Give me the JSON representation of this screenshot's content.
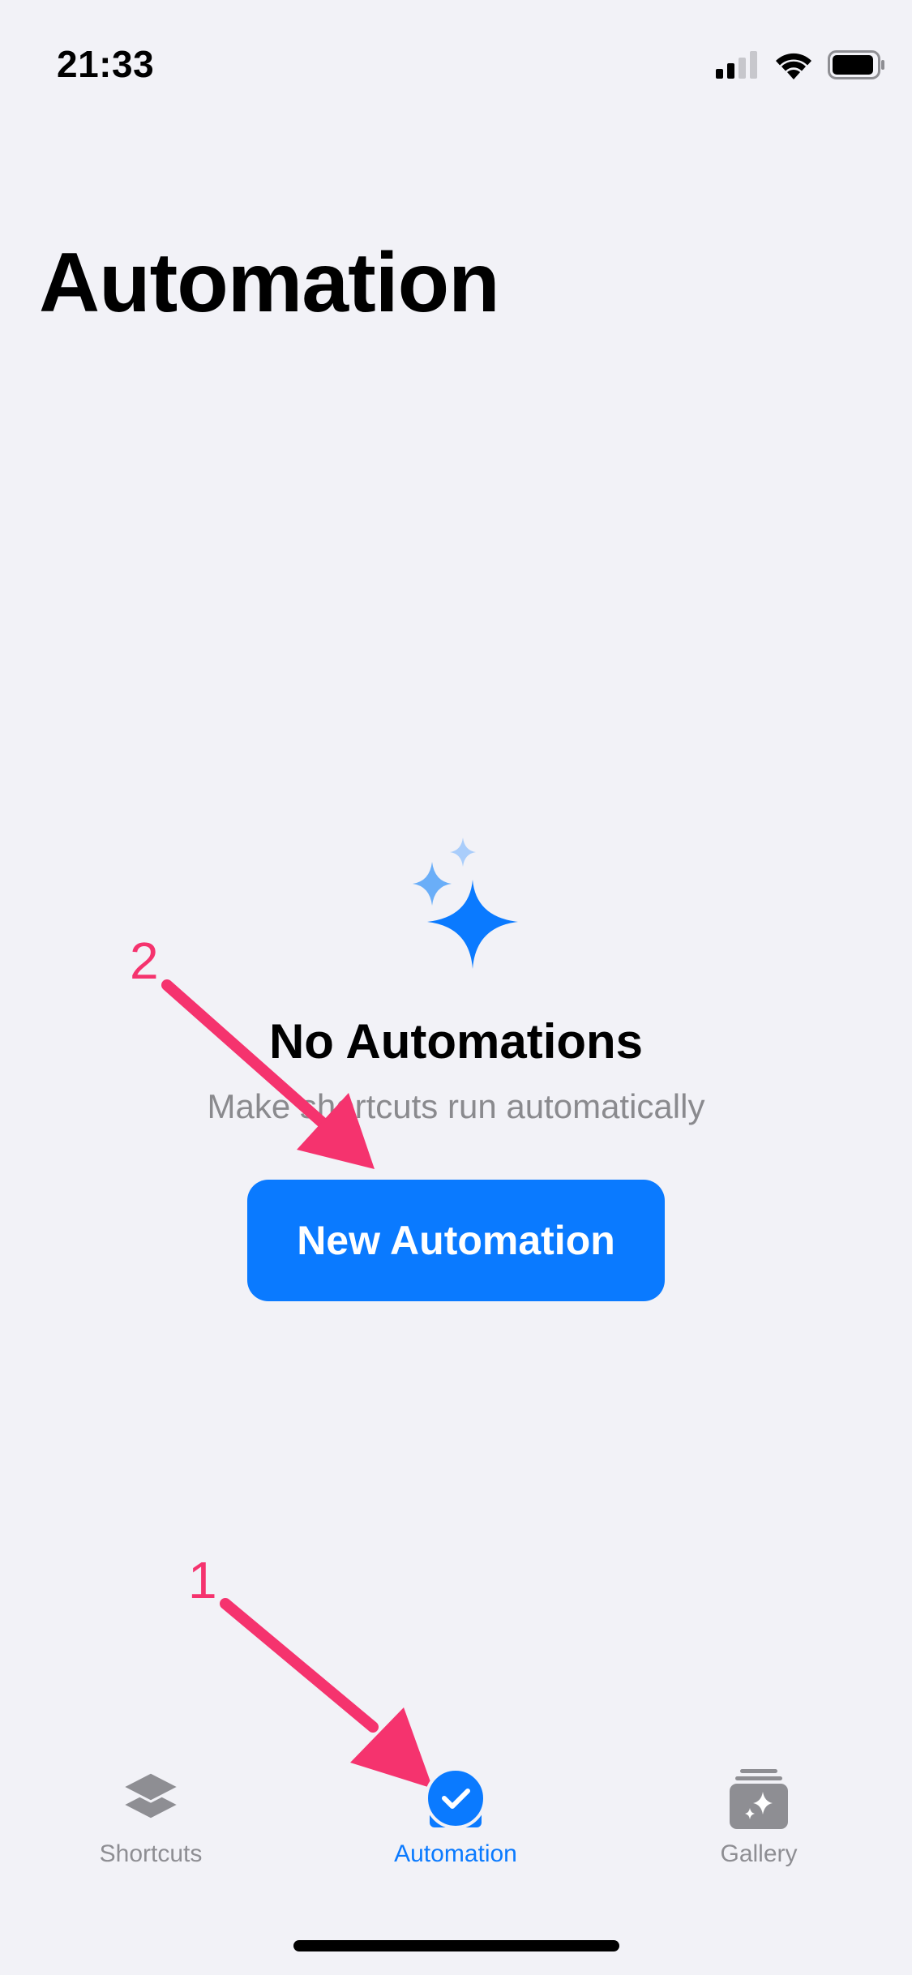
{
  "status_bar": {
    "time": "21:33"
  },
  "page": {
    "title": "Automation"
  },
  "empty_state": {
    "title": "No Automations",
    "subtitle": "Make shortcuts run automatically",
    "button_label": "New Automation"
  },
  "annotations": [
    {
      "label": "1"
    },
    {
      "label": "2"
    }
  ],
  "tab_bar": {
    "tabs": [
      {
        "label": "Shortcuts",
        "icon": "layers-icon",
        "active": false
      },
      {
        "label": "Automation",
        "icon": "clock-checkmark-icon",
        "active": true
      },
      {
        "label": "Gallery",
        "icon": "gallery-sparkle-icon",
        "active": false
      }
    ]
  },
  "colors": {
    "background": "#f2f2f7",
    "accent": "#0a7aff",
    "annotation": "#f5336e",
    "inactive_tab": "#8e8e93",
    "subtitle": "#8a8a8e"
  }
}
